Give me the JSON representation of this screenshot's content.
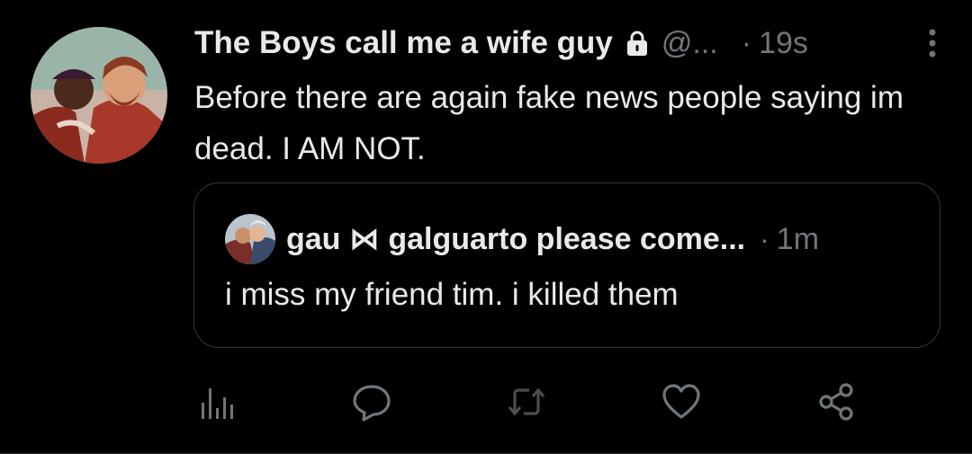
{
  "tweet": {
    "display_name": "The Boys call me a wife guy",
    "handle": "@...",
    "separator": "·",
    "time": "19s",
    "text": "Before there are again fake news people saying im dead. I AM NOT.",
    "protected_icon": "lock-icon",
    "more_icon": "more-vertical-icon"
  },
  "quote": {
    "display_name": "gau ⋈ galguarto please come...",
    "separator": "·",
    "time": "1m",
    "text": "i miss my friend tim. i killed them"
  },
  "actions": [
    {
      "icon": "analytics-icon"
    },
    {
      "icon": "reply-icon"
    },
    {
      "icon": "retweet-icon"
    },
    {
      "icon": "like-icon"
    },
    {
      "icon": "share-icon"
    }
  ],
  "colors": {
    "background": "#000000",
    "text_primary": "#e7e9ea",
    "text_secondary": "#71767b",
    "border": "#38393c"
  }
}
